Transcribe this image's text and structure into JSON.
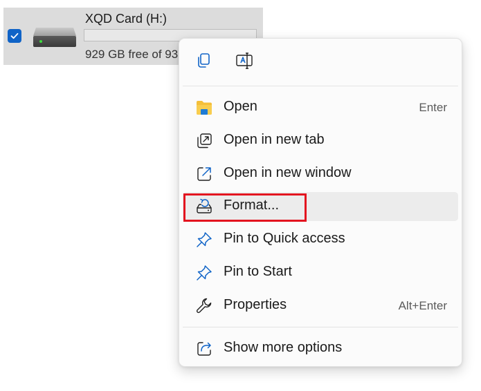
{
  "drive": {
    "name": "XQD Card (H:)",
    "free_text": "929 GB free of 93",
    "selected": true,
    "icon": "hard-drive-icon",
    "used_fraction": 0.0
  },
  "context_menu": {
    "quick_actions": [
      {
        "name": "copy",
        "icon": "copy-icon"
      },
      {
        "name": "rename",
        "icon": "rename-icon"
      }
    ],
    "items": [
      {
        "label": "Open",
        "shortcut": "Enter",
        "icon": "folder-icon"
      },
      {
        "label": "Open in new tab",
        "shortcut": "",
        "icon": "open-new-tab-icon"
      },
      {
        "label": "Open in new window",
        "shortcut": "",
        "icon": "open-new-window-icon"
      },
      {
        "label": "Format...",
        "shortcut": "",
        "icon": "format-icon",
        "highlighted": true
      },
      {
        "label": "Pin to Quick access",
        "shortcut": "",
        "icon": "pin-icon"
      },
      {
        "label": "Pin to Start",
        "shortcut": "",
        "icon": "pin-icon"
      },
      {
        "label": "Properties",
        "shortcut": "Alt+Enter",
        "icon": "wrench-icon"
      }
    ],
    "more_options": {
      "label": "Show more options",
      "icon": "share-icon"
    }
  },
  "colors": {
    "accent": "#0f63c7",
    "highlight_border": "#e3141f",
    "folder_yellow": "#f4bf3a"
  }
}
